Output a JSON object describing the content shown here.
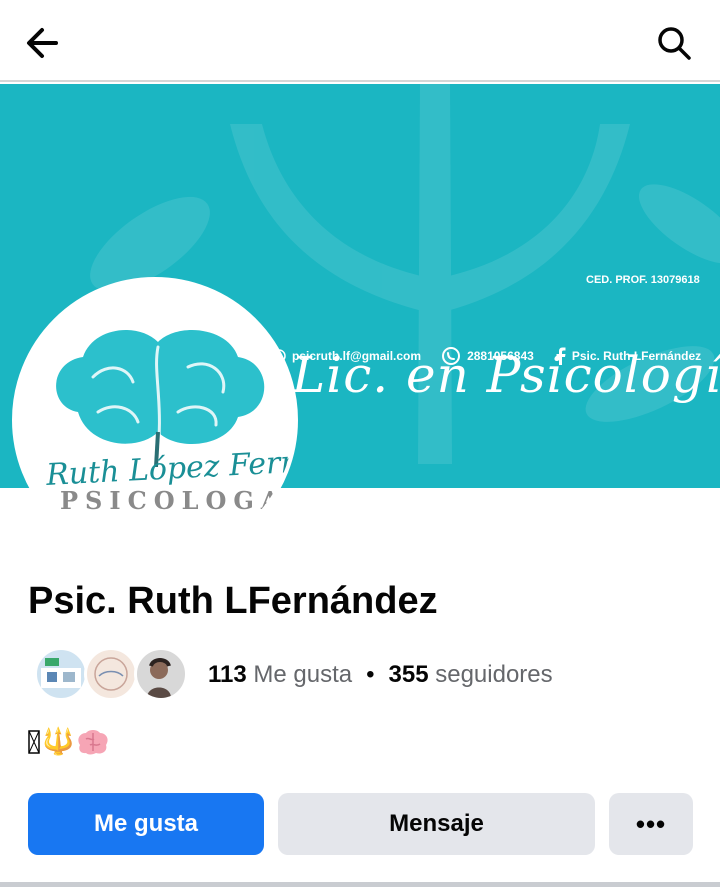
{
  "header": {
    "back_icon": "arrow-left-icon",
    "search_icon": "search-icon"
  },
  "cover": {
    "title": "Lic. en Psicología",
    "ced": "CED. PROF. 13079618",
    "email": "psicruth.lf@gmail.com",
    "phone": "2881056843",
    "facebook": "Psic. Ruth LFernández",
    "accent": "#1bb6c2"
  },
  "avatar": {
    "signature": "Ruth López Fernández",
    "role": "PSICOLOGA"
  },
  "page": {
    "name": "Psic. Ruth LFernández",
    "likes_count": "113",
    "likes_label": "Me gusta",
    "separator": "•",
    "followers_count": "355",
    "followers_label": "seguidores",
    "bio": "🔱"
  },
  "actions": {
    "like": "Me gusta",
    "message": "Mensaje",
    "more": "•••"
  },
  "colors": {
    "primary": "#1877f2",
    "secondary_button": "#e4e6eb"
  }
}
